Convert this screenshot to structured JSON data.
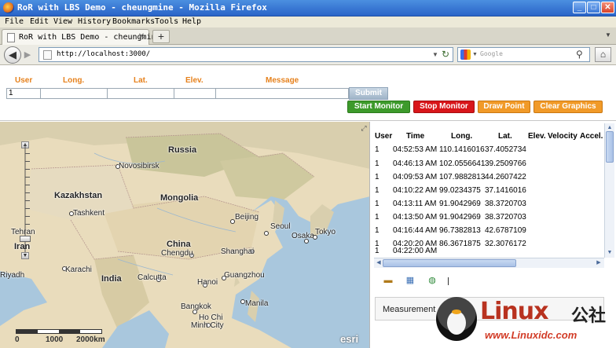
{
  "browser": {
    "title": "RoR with LBS Demo - cheungmine - Mozilla Firefox",
    "menu": [
      "File",
      "Edit",
      "View",
      "History",
      "Bookmarks",
      "Tools",
      "Help"
    ],
    "tab_title": "RoR with LBS Demo - cheungmine",
    "url": "http://localhost:3000/",
    "search_placeholder": "Google"
  },
  "form": {
    "labels": {
      "user": "User",
      "long": "Long.",
      "lat": "Lat.",
      "elev": "Elev.",
      "message": "Message"
    },
    "values": {
      "user": "1",
      "long": "",
      "lat": "",
      "elev": "",
      "message": ""
    },
    "submit": "Submit",
    "buttons": {
      "start": "Start Monitor",
      "stop": "Stop Monitor",
      "draw": "Draw Point",
      "clear": "Clear Graphics"
    }
  },
  "map": {
    "labels": {
      "russia": "Russia",
      "novosibirsk": "Novosibirsk",
      "kazakhstan": "Kazakhstan",
      "mongolia": "Mongolia",
      "tashkent": "Tashkent",
      "beijing": "Beijing",
      "seoul": "Seoul",
      "osaka": "Osaka",
      "tokyo": "Tokyo",
      "tehran": "Tehran",
      "iran": "Iran",
      "china": "China",
      "chengdu": "Chengdu",
      "shanghai": "Shanghai",
      "karachi": "Karachi",
      "riyadh": "Riyadh",
      "india": "India",
      "calcutta": "Calcutta",
      "hanoi": "Hanoi",
      "guangzhou": "Guangzhou",
      "manila": "Manila",
      "bangkok": "Bangkok",
      "hochi": "Ho Chi",
      "minhcity": "Minh City"
    },
    "scale": {
      "s0": "0",
      "s1": "1000",
      "s2": "2000km"
    },
    "attribution": "esri"
  },
  "table": {
    "headers": {
      "user": "User",
      "time": "Time",
      "long": "Long.",
      "lat": "Lat.",
      "elev": "Elev.",
      "velocity": "Velocity",
      "accel": "Accel."
    },
    "rows": [
      {
        "user": "1",
        "time": "04:52:53 AM",
        "long": "110.1416016",
        "lat": "37.4052734"
      },
      {
        "user": "1",
        "time": "04:46:13 AM",
        "long": "102.0556641",
        "lat": "39.2509766"
      },
      {
        "user": "1",
        "time": "04:09:53 AM",
        "long": "107.9882813",
        "lat": "44.2607422"
      },
      {
        "user": "1",
        "time": "04:10:22 AM",
        "long": "99.0234375",
        "lat": "37.1416016"
      },
      {
        "user": "1",
        "time": "04:13:11 AM",
        "long": "91.9042969",
        "lat": "38.3720703"
      },
      {
        "user": "1",
        "time": "04:13:50 AM",
        "long": "91.9042969",
        "lat": "38.3720703"
      },
      {
        "user": "1",
        "time": "04:16:44 AM",
        "long": "96.7382813",
        "lat": "42.6787109"
      },
      {
        "user": "1",
        "time": "04:20:20 AM",
        "long": "86.3671875",
        "lat": "32.3076172"
      },
      {
        "user": "1",
        "time": "04:22:00 AM",
        "long": "",
        "lat": ""
      }
    ]
  },
  "measurement": {
    "label": "Measurement"
  },
  "watermark": {
    "brand": "Linux",
    "brand_cn": "公社",
    "site": "www.Linuxidc.com"
  }
}
